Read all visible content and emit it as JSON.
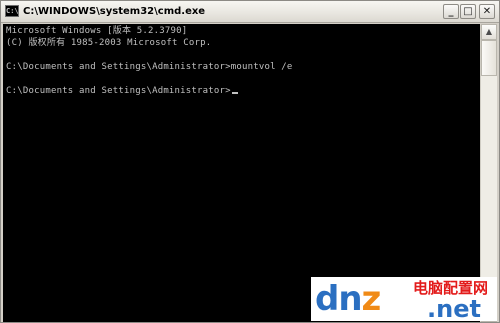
{
  "window": {
    "title": "C:\\WINDOWS\\system32\\cmd.exe",
    "icon": "cmd-icon",
    "buttons": {
      "minimize": "_",
      "maximize": "□",
      "close": "✕"
    }
  },
  "console": {
    "lines": [
      "Microsoft Windows [版本 5.2.3790]",
      "(C) 版权所有 1985-2003 Microsoft Corp.",
      "",
      "C:\\Documents and Settings\\Administrator>mountvol /e",
      "",
      "C:\\Documents and Settings\\Administrator>"
    ],
    "text_color": "#c0c0c0",
    "background": "#000000"
  },
  "scrollbar": {
    "up_arrow": "▲",
    "down_arrow": "▼"
  },
  "watermark": {
    "logo_prefix": "dn",
    "logo_z": "z",
    "logo_suffix": "",
    "chinese": "电脑配置网",
    "domain": ".net"
  }
}
